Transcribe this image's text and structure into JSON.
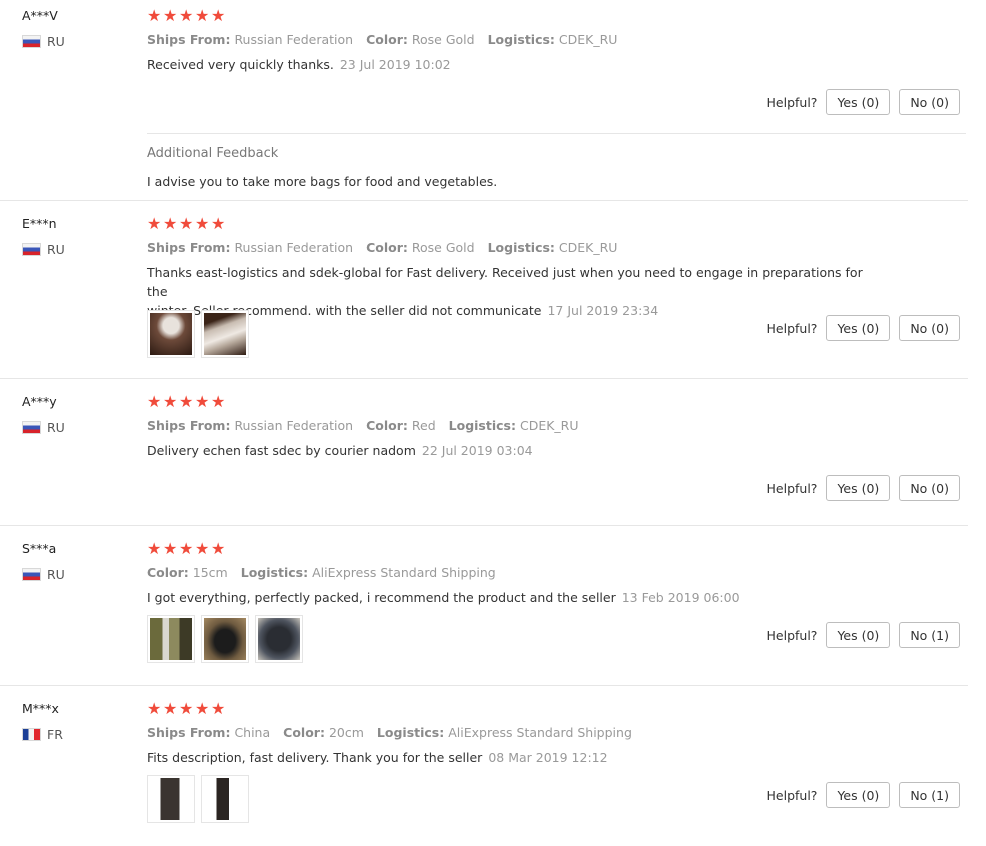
{
  "labels": {
    "ships_from": "Ships From:",
    "color": "Color:",
    "logistics": "Logistics:",
    "helpful": "Helpful?",
    "additional_feedback": "Additional Feedback"
  },
  "colors": {
    "star": "#f04b3b",
    "muted_text": "#999999",
    "button_border": "#bdbdbd"
  },
  "reviews": [
    {
      "user": "A***V",
      "country": "RU",
      "stars": 5,
      "ships_from": "Russian Federation",
      "color": "Rose Gold",
      "logistics": "CDEK_RU",
      "text": "Received very quickly thanks.",
      "time": "23 Jul 2019 10:02",
      "yes": "Yes (0)",
      "no": "No (0)",
      "additional_feedback": "I advise you to take more bags for food and vegetables."
    },
    {
      "user": "E***n",
      "country": "RU",
      "stars": 5,
      "ships_from": "Russian Federation",
      "color": "Rose Gold",
      "logistics": "CDEK_RU",
      "text_line1": "Thanks east-logistics and sdek-global for Fast delivery. Received just when you need to engage in preparations for the",
      "text_line2": "winter. Seller recommend. with the seller did not communicate",
      "time": "17 Jul 2019 23:34",
      "images": [
        "photo-bag-hand",
        "photo-bag-roll"
      ],
      "yes": "Yes (0)",
      "no": "No (0)"
    },
    {
      "user": "A***y",
      "country": "RU",
      "stars": 5,
      "ships_from": "Russian Federation",
      "color": "Red",
      "logistics": "CDEK_RU",
      "text": "Delivery echen fast sdec by courier nadom",
      "time": "22 Jul 2019 03:04",
      "yes": "Yes (0)",
      "no": "No (0)"
    },
    {
      "user": "S***a",
      "country": "RU",
      "stars": 5,
      "color": "15cm",
      "logistics": "AliExpress Standard Shipping",
      "text": "I got everything, perfectly packed, i recommend the product and the seller",
      "time": "13 Feb 2019 06:00",
      "images": [
        "photo-shelf",
        "photo-package",
        "photo-dark-bag"
      ],
      "yes": "Yes (0)",
      "no": "No (1)"
    },
    {
      "user": "M***x",
      "country": "FR",
      "stars": 5,
      "ships_from": "China",
      "color": "20cm",
      "logistics": "AliExpress Standard Shipping",
      "text": "Fits description, fast delivery. Thank you for the seller",
      "time": "08 Mar 2019 12:12",
      "images": [
        "photo-roll-box",
        "photo-roll-tall"
      ],
      "yes": "Yes (0)",
      "no": "No (1)"
    }
  ]
}
